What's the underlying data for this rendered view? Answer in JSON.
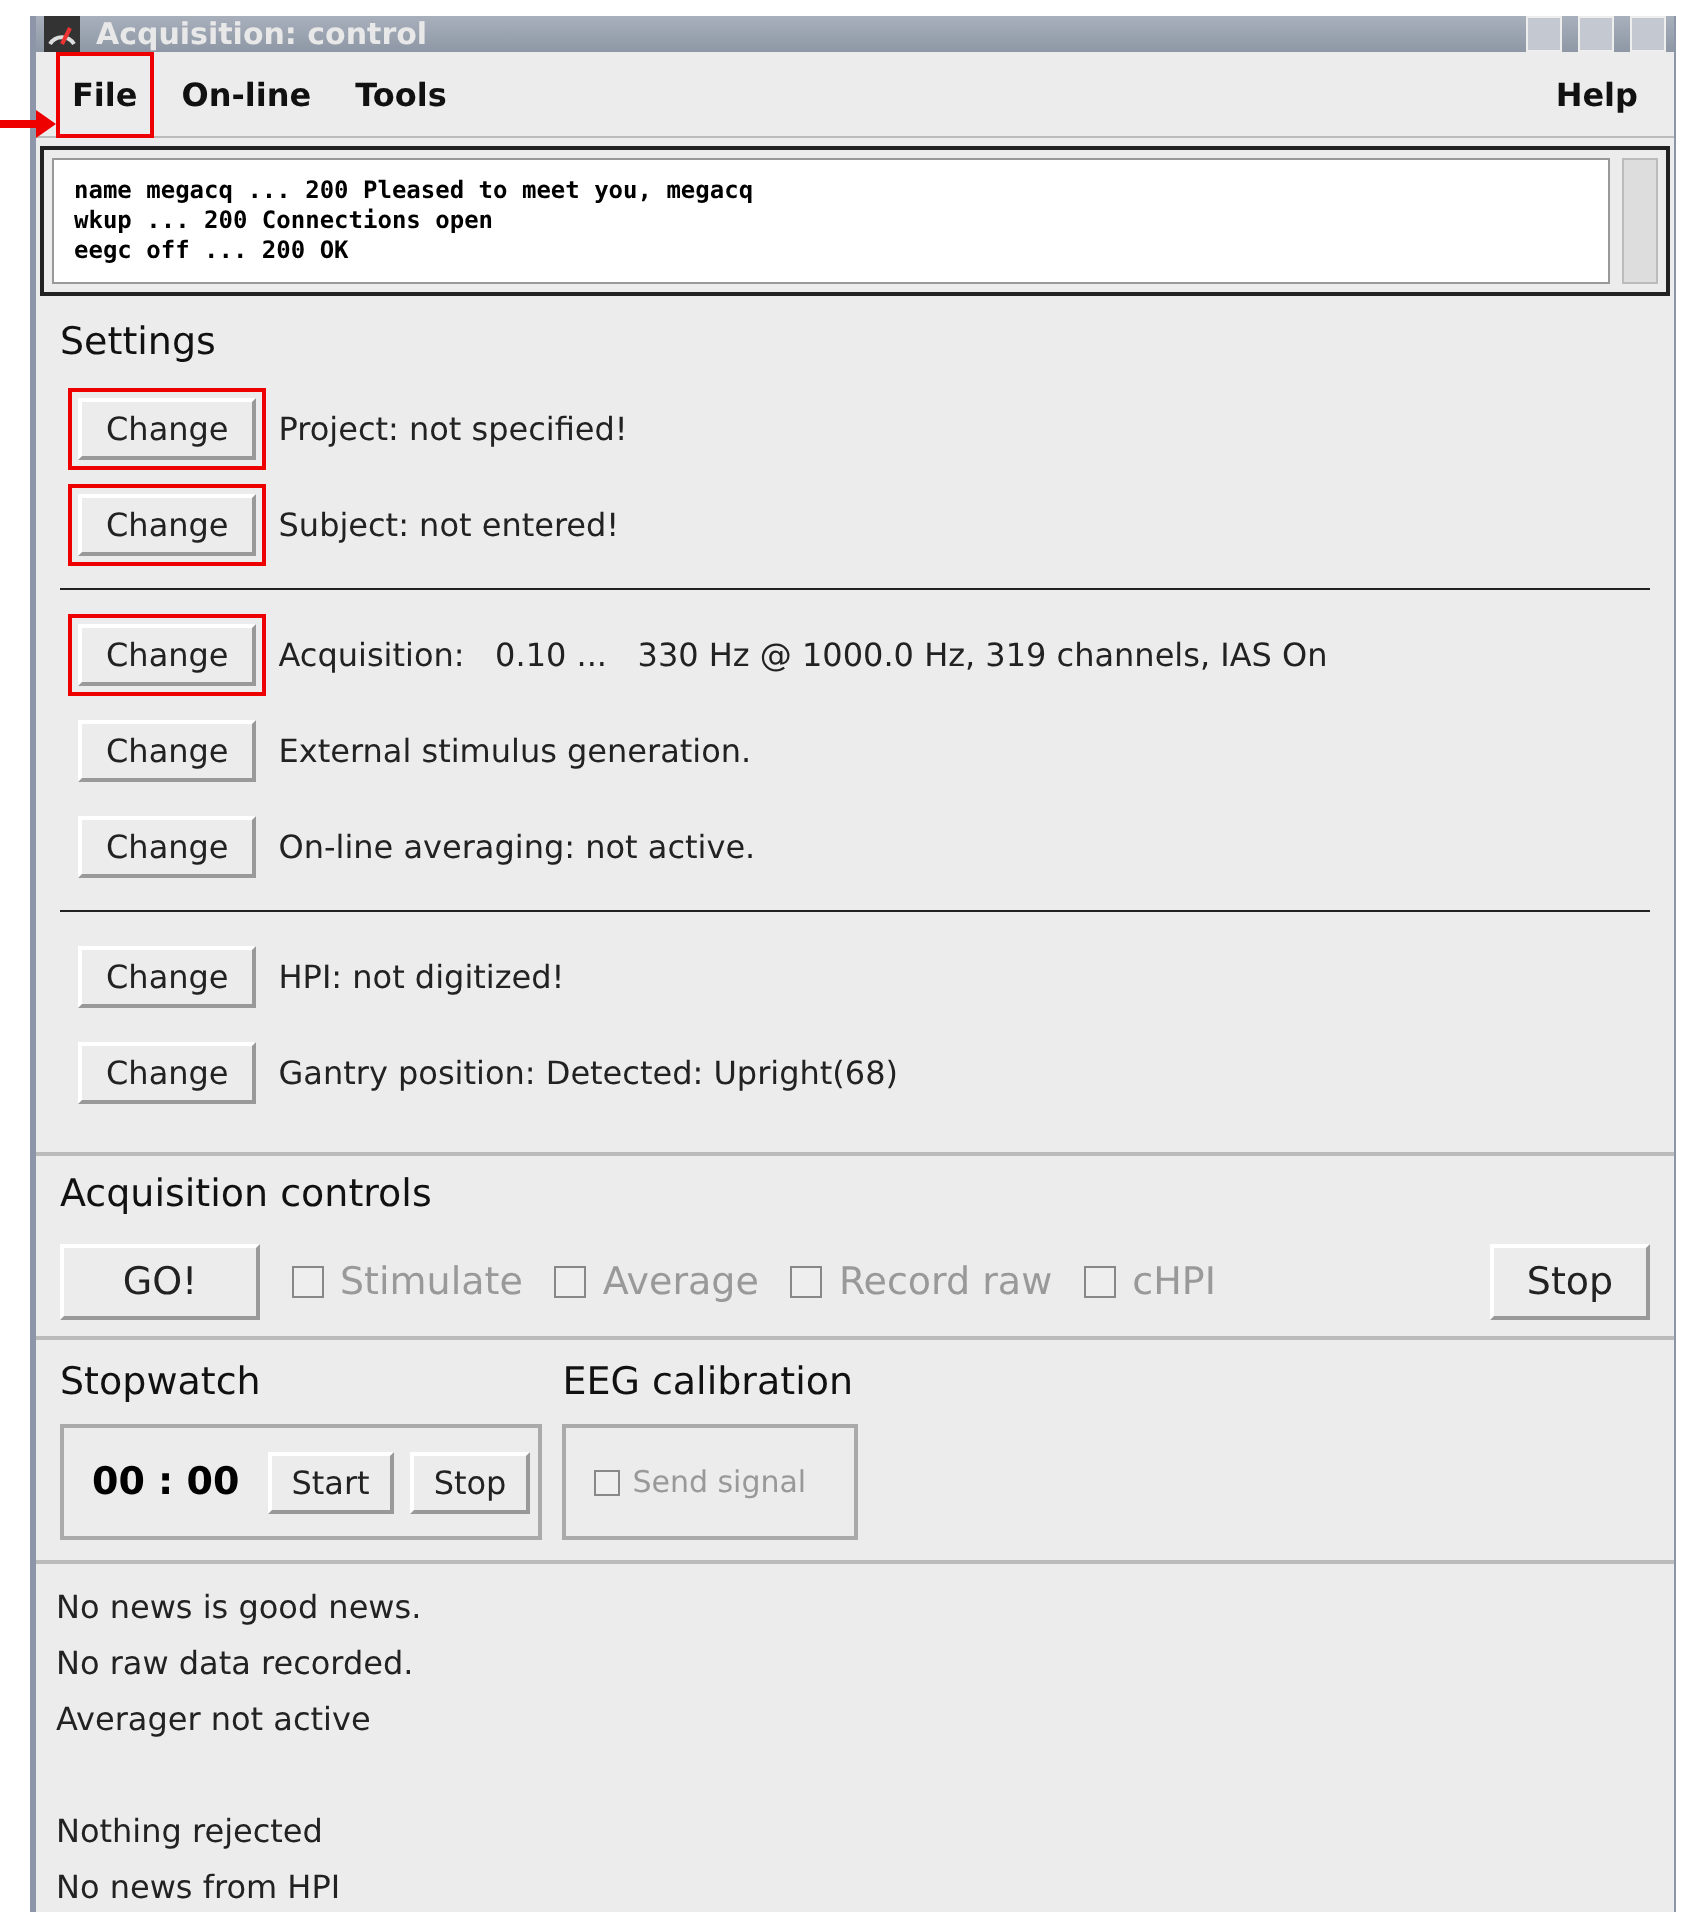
{
  "window": {
    "title": "Acquisition: control"
  },
  "menu": [
    {
      "label": "File",
      "highlighted": true
    },
    {
      "label": "On-line",
      "highlighted": false
    },
    {
      "label": "Tools",
      "highlighted": false
    },
    {
      "label": "Help",
      "highlighted": false
    }
  ],
  "log": [
    "name megacq ... 200 Pleased to meet you, megacq",
    "wkup ... 200 Connections open",
    "eegc off ... 200 OK"
  ],
  "settings": {
    "title": "Settings",
    "groups": [
      [
        {
          "button": "Change",
          "text": "Project: not specified!",
          "highlighted": true
        },
        {
          "button": "Change",
          "text": "Subject: not entered!",
          "highlighted": true
        }
      ],
      [
        {
          "button": "Change",
          "text": "Acquisition:   0.10 ...   330 Hz @ 1000.0 Hz, 319 channels, IAS On",
          "highlighted": true
        },
        {
          "button": "Change",
          "text": "External stimulus generation.",
          "highlighted": false
        },
        {
          "button": "Change",
          "text": "On-line averaging: not active.",
          "highlighted": false
        }
      ],
      [
        {
          "button": "Change",
          "text": "HPI: not digitized!",
          "highlighted": false
        },
        {
          "button": "Change",
          "text": "Gantry position: Detected: Upright(68)",
          "highlighted": false
        }
      ]
    ]
  },
  "acquisition_controls": {
    "title": "Acquisition controls",
    "go": "GO!",
    "checkboxes": [
      {
        "label": "Stimulate",
        "checked": false,
        "disabled": true
      },
      {
        "label": "Average",
        "checked": false,
        "disabled": true
      },
      {
        "label": "Record raw",
        "checked": false,
        "disabled": true
      },
      {
        "label": "cHPI",
        "checked": false,
        "disabled": true
      }
    ],
    "stop": "Stop"
  },
  "stopwatch": {
    "title": "Stopwatch",
    "time": "00 : 00",
    "start": "Start",
    "stop": "Stop"
  },
  "eeg_calibration": {
    "title": "EEG calibration",
    "checkbox": {
      "label": "Send signal",
      "checked": false,
      "disabled": true
    }
  },
  "status_groups": [
    [
      "No news is good news.",
      "No raw data recorded.",
      "Averager not active"
    ],
    [
      "Nothing rejected",
      "No news from HPI"
    ]
  ]
}
